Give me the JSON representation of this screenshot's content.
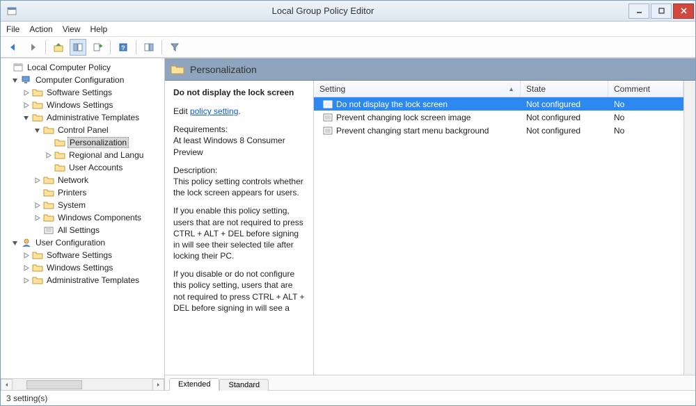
{
  "window": {
    "title": "Local Group Policy Editor"
  },
  "menu": {
    "file": "File",
    "action": "Action",
    "view": "View",
    "help": "Help"
  },
  "toolbar": {
    "back": "back",
    "forward": "forward",
    "up": "up",
    "show_hide_tree": "show-hide-tree",
    "export": "export",
    "help": "help",
    "show_hide_action": "show-hide-action",
    "filter": "filter"
  },
  "tree": {
    "root": "Local Computer Policy",
    "computer_config": "Computer Configuration",
    "cc_software": "Software Settings",
    "cc_windows": "Windows Settings",
    "cc_admin": "Administrative Templates",
    "cc_control_panel": "Control Panel",
    "cc_personalization": "Personalization",
    "cc_regional": "Regional and Langu",
    "cc_user_accounts": "User Accounts",
    "cc_network": "Network",
    "cc_printers": "Printers",
    "cc_system": "System",
    "cc_win_components": "Windows Components",
    "cc_all_settings": "All Settings",
    "user_config": "User Configuration",
    "uc_software": "Software Settings",
    "uc_windows": "Windows Settings",
    "uc_admin": "Administrative Templates"
  },
  "detail": {
    "title": "Personalization",
    "policy_title": "Do not display the lock screen",
    "edit_prefix": "Edit ",
    "edit_link": "policy setting",
    "edit_suffix": ".",
    "req_label": "Requirements:",
    "req_text": "At least Windows 8 Consumer Preview",
    "desc_label": "Description:",
    "desc_1": "This policy setting controls whether the lock screen appears for users.",
    "desc_2": "If you enable this policy setting, users that are not required to press CTRL + ALT + DEL before signing in will see their selected tile after locking their PC.",
    "desc_3": "If you disable or do not configure this policy setting, users that are not required to press CTRL + ALT + DEL before signing in will see a"
  },
  "columns": {
    "setting": "Setting",
    "state": "State",
    "comment": "Comment"
  },
  "rows": [
    {
      "setting": "Do not display the lock screen",
      "state": "Not configured",
      "comment": "No",
      "selected": true
    },
    {
      "setting": "Prevent changing lock screen image",
      "state": "Not configured",
      "comment": "No",
      "selected": false
    },
    {
      "setting": "Prevent changing start menu background",
      "state": "Not configured",
      "comment": "No",
      "selected": false
    }
  ],
  "tabs": {
    "extended": "Extended",
    "standard": "Standard"
  },
  "status": "3 setting(s)"
}
